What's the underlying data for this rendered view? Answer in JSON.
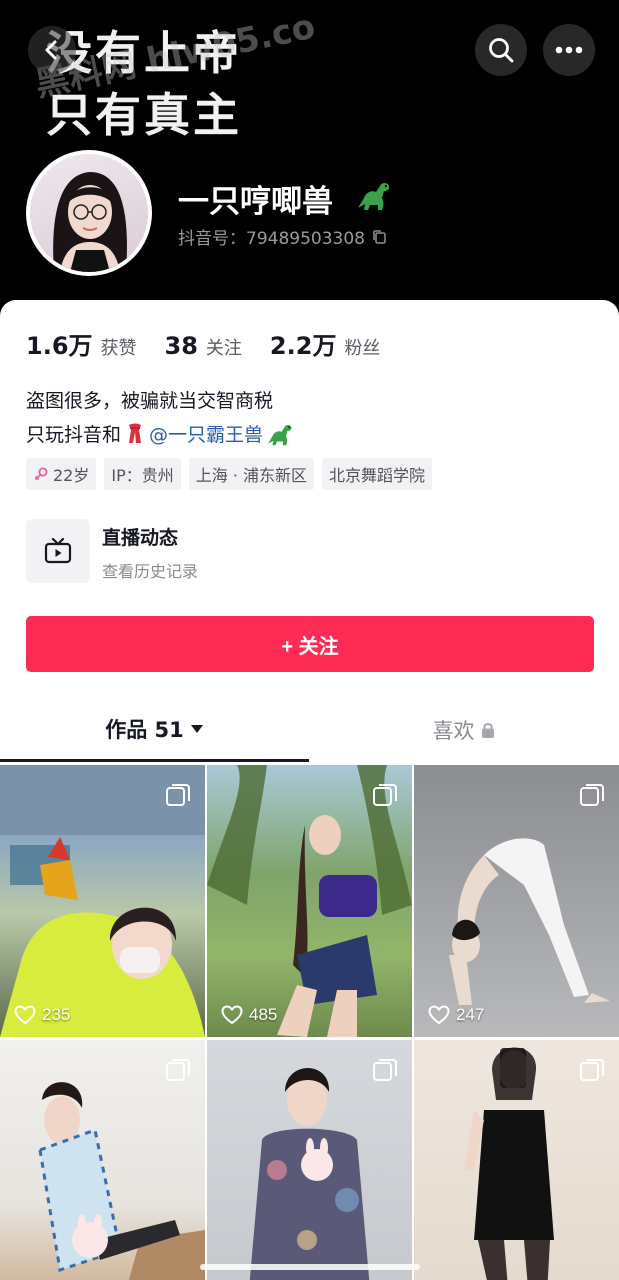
{
  "header": {
    "banner_line1": "没有上帝",
    "banner_line2": "只有真主",
    "watermark": "黑料网 hlw05.co",
    "nickname": "一只哼唧兽",
    "douyin_id": "抖音号：79489503308"
  },
  "stats": [
    {
      "num": "1.6万",
      "label": "获赞"
    },
    {
      "num": "38",
      "label": "关注"
    },
    {
      "num": "2.2万",
      "label": "粉丝"
    }
  ],
  "bio": {
    "line1": "盗图很多，被骗就当交智商税",
    "line2_prefix": "只玩抖音和",
    "mention": "@一只霸王兽"
  },
  "tags": [
    "22岁",
    "IP：贵州",
    "上海 · 浦东新区",
    "北京舞蹈学院"
  ],
  "live": {
    "title": "直播动态",
    "subtitle": "查看历史记录"
  },
  "follow_button": "+ 关注",
  "tabs": {
    "works": "作品 51",
    "likes": "喜欢"
  },
  "videos": [
    {
      "likes": "235"
    },
    {
      "likes": "485"
    },
    {
      "likes": "247"
    },
    {
      "likes": ""
    },
    {
      "likes": ""
    },
    {
      "likes": ""
    }
  ],
  "colors": {
    "accent": "#fe2c55",
    "mention": "#2a5caa",
    "header_bg": "#000000"
  }
}
